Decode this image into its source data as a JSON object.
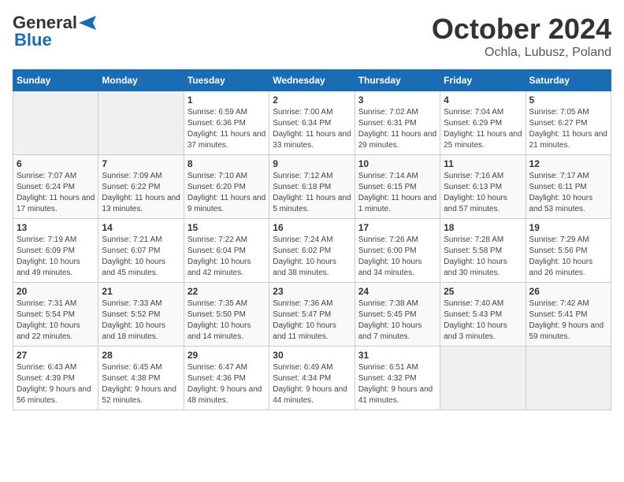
{
  "header": {
    "logo_general": "General",
    "logo_blue": "Blue",
    "month_title": "October 2024",
    "subtitle": "Ochla, Lubusz, Poland"
  },
  "days_of_week": [
    "Sunday",
    "Monday",
    "Tuesday",
    "Wednesday",
    "Thursday",
    "Friday",
    "Saturday"
  ],
  "weeks": [
    [
      {
        "day": "",
        "info": ""
      },
      {
        "day": "",
        "info": ""
      },
      {
        "day": "1",
        "info": "Sunrise: 6:59 AM\nSunset: 6:36 PM\nDaylight: 11 hours and 37 minutes."
      },
      {
        "day": "2",
        "info": "Sunrise: 7:00 AM\nSunset: 6:34 PM\nDaylight: 11 hours and 33 minutes."
      },
      {
        "day": "3",
        "info": "Sunrise: 7:02 AM\nSunset: 6:31 PM\nDaylight: 11 hours and 29 minutes."
      },
      {
        "day": "4",
        "info": "Sunrise: 7:04 AM\nSunset: 6:29 PM\nDaylight: 11 hours and 25 minutes."
      },
      {
        "day": "5",
        "info": "Sunrise: 7:05 AM\nSunset: 6:27 PM\nDaylight: 11 hours and 21 minutes."
      }
    ],
    [
      {
        "day": "6",
        "info": "Sunrise: 7:07 AM\nSunset: 6:24 PM\nDaylight: 11 hours and 17 minutes."
      },
      {
        "day": "7",
        "info": "Sunrise: 7:09 AM\nSunset: 6:22 PM\nDaylight: 11 hours and 13 minutes."
      },
      {
        "day": "8",
        "info": "Sunrise: 7:10 AM\nSunset: 6:20 PM\nDaylight: 11 hours and 9 minutes."
      },
      {
        "day": "9",
        "info": "Sunrise: 7:12 AM\nSunset: 6:18 PM\nDaylight: 11 hours and 5 minutes."
      },
      {
        "day": "10",
        "info": "Sunrise: 7:14 AM\nSunset: 6:15 PM\nDaylight: 11 hours and 1 minute."
      },
      {
        "day": "11",
        "info": "Sunrise: 7:16 AM\nSunset: 6:13 PM\nDaylight: 10 hours and 57 minutes."
      },
      {
        "day": "12",
        "info": "Sunrise: 7:17 AM\nSunset: 6:11 PM\nDaylight: 10 hours and 53 minutes."
      }
    ],
    [
      {
        "day": "13",
        "info": "Sunrise: 7:19 AM\nSunset: 6:09 PM\nDaylight: 10 hours and 49 minutes."
      },
      {
        "day": "14",
        "info": "Sunrise: 7:21 AM\nSunset: 6:07 PM\nDaylight: 10 hours and 45 minutes."
      },
      {
        "day": "15",
        "info": "Sunrise: 7:22 AM\nSunset: 6:04 PM\nDaylight: 10 hours and 42 minutes."
      },
      {
        "day": "16",
        "info": "Sunrise: 7:24 AM\nSunset: 6:02 PM\nDaylight: 10 hours and 38 minutes."
      },
      {
        "day": "17",
        "info": "Sunrise: 7:26 AM\nSunset: 6:00 PM\nDaylight: 10 hours and 34 minutes."
      },
      {
        "day": "18",
        "info": "Sunrise: 7:28 AM\nSunset: 5:58 PM\nDaylight: 10 hours and 30 minutes."
      },
      {
        "day": "19",
        "info": "Sunrise: 7:29 AM\nSunset: 5:56 PM\nDaylight: 10 hours and 26 minutes."
      }
    ],
    [
      {
        "day": "20",
        "info": "Sunrise: 7:31 AM\nSunset: 5:54 PM\nDaylight: 10 hours and 22 minutes."
      },
      {
        "day": "21",
        "info": "Sunrise: 7:33 AM\nSunset: 5:52 PM\nDaylight: 10 hours and 18 minutes."
      },
      {
        "day": "22",
        "info": "Sunrise: 7:35 AM\nSunset: 5:50 PM\nDaylight: 10 hours and 14 minutes."
      },
      {
        "day": "23",
        "info": "Sunrise: 7:36 AM\nSunset: 5:47 PM\nDaylight: 10 hours and 11 minutes."
      },
      {
        "day": "24",
        "info": "Sunrise: 7:38 AM\nSunset: 5:45 PM\nDaylight: 10 hours and 7 minutes."
      },
      {
        "day": "25",
        "info": "Sunrise: 7:40 AM\nSunset: 5:43 PM\nDaylight: 10 hours and 3 minutes."
      },
      {
        "day": "26",
        "info": "Sunrise: 7:42 AM\nSunset: 5:41 PM\nDaylight: 9 hours and 59 minutes."
      }
    ],
    [
      {
        "day": "27",
        "info": "Sunrise: 6:43 AM\nSunset: 4:39 PM\nDaylight: 9 hours and 56 minutes."
      },
      {
        "day": "28",
        "info": "Sunrise: 6:45 AM\nSunset: 4:38 PM\nDaylight: 9 hours and 52 minutes."
      },
      {
        "day": "29",
        "info": "Sunrise: 6:47 AM\nSunset: 4:36 PM\nDaylight: 9 hours and 48 minutes."
      },
      {
        "day": "30",
        "info": "Sunrise: 6:49 AM\nSunset: 4:34 PM\nDaylight: 9 hours and 44 minutes."
      },
      {
        "day": "31",
        "info": "Sunrise: 6:51 AM\nSunset: 4:32 PM\nDaylight: 9 hours and 41 minutes."
      },
      {
        "day": "",
        "info": ""
      },
      {
        "day": "",
        "info": ""
      }
    ]
  ]
}
